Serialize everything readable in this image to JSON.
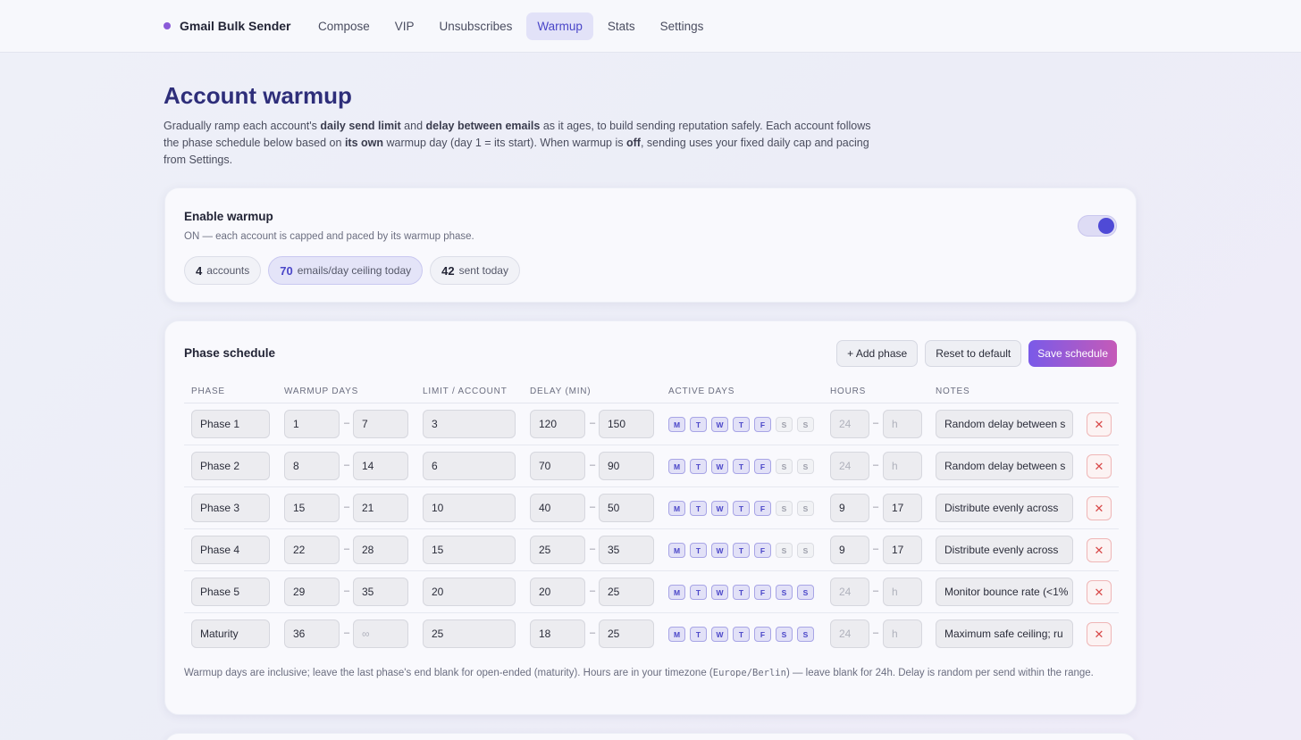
{
  "app": {
    "name": "Gmail Bulk Sender"
  },
  "nav": [
    {
      "label": "Compose",
      "active": false
    },
    {
      "label": "VIP",
      "active": false
    },
    {
      "label": "Unsubscribes",
      "active": false
    },
    {
      "label": "Warmup",
      "active": true
    },
    {
      "label": "Stats",
      "active": false
    },
    {
      "label": "Settings",
      "active": false
    }
  ],
  "page": {
    "title": "Account warmup",
    "intro": {
      "t1": "Gradually ramp each account's ",
      "b1": "daily send limit",
      "t2": " and ",
      "b2": "delay between emails",
      "t3": " as it ages, to build sending reputation safely. Each account follows the phase schedule below based on ",
      "b3": "its own",
      "t4": " warmup day (day 1 = its start). When warmup is ",
      "b4": "off",
      "t5": ", sending uses your fixed daily cap and pacing from Settings."
    }
  },
  "warmup": {
    "title": "Enable warmup",
    "subtitle": "ON — each account is capped and paced by its warmup phase.",
    "enabled": true,
    "stats": [
      {
        "value": "4",
        "label": "accounts"
      },
      {
        "value": "70",
        "label": "emails/day ceiling today"
      },
      {
        "value": "42",
        "label": "sent today"
      }
    ]
  },
  "schedule": {
    "title": "Phase schedule",
    "buttons": {
      "add": "+ Add phase",
      "reset": "Reset to default",
      "save": "Save schedule"
    },
    "columns": [
      "PHASE",
      "WARMUP DAYS",
      "LIMIT / ACCOUNT",
      "DELAY (MIN)",
      "ACTIVE DAYS",
      "HOURS",
      "NOTES"
    ],
    "day_letters": [
      "M",
      "T",
      "W",
      "T",
      "F",
      "S",
      "S"
    ],
    "hour_placeholders": {
      "start": "24",
      "end": "h"
    },
    "dash": "–",
    "rows": [
      {
        "phase": "Phase 1",
        "day_start": "1",
        "day_end": "7",
        "limit": "3",
        "delay_min": "120",
        "delay_max": "150",
        "active": [
          true,
          true,
          true,
          true,
          true,
          false,
          false
        ],
        "hour_start": "",
        "hour_end": "",
        "notes": "Random delay between s"
      },
      {
        "phase": "Phase 2",
        "day_start": "8",
        "day_end": "14",
        "limit": "6",
        "delay_min": "70",
        "delay_max": "90",
        "active": [
          true,
          true,
          true,
          true,
          true,
          false,
          false
        ],
        "hour_start": "",
        "hour_end": "",
        "notes": "Random delay between s"
      },
      {
        "phase": "Phase 3",
        "day_start": "15",
        "day_end": "21",
        "limit": "10",
        "delay_min": "40",
        "delay_max": "50",
        "active": [
          true,
          true,
          true,
          true,
          true,
          false,
          false
        ],
        "hour_start": "9",
        "hour_end": "17",
        "notes": "Distribute evenly across"
      },
      {
        "phase": "Phase 4",
        "day_start": "22",
        "day_end": "28",
        "limit": "15",
        "delay_min": "25",
        "delay_max": "35",
        "active": [
          true,
          true,
          true,
          true,
          true,
          false,
          false
        ],
        "hour_start": "9",
        "hour_end": "17",
        "notes": "Distribute evenly across"
      },
      {
        "phase": "Phase 5",
        "day_start": "29",
        "day_end": "35",
        "limit": "20",
        "delay_min": "20",
        "delay_max": "25",
        "active": [
          true,
          true,
          true,
          true,
          true,
          true,
          true
        ],
        "hour_start": "",
        "hour_end": "",
        "notes": "Monitor bounce rate (<1%"
      },
      {
        "phase": "Maturity",
        "day_start": "36",
        "day_end": "∞",
        "day_end_placeholder": true,
        "limit": "25",
        "delay_min": "18",
        "delay_max": "25",
        "active": [
          true,
          true,
          true,
          true,
          true,
          true,
          true
        ],
        "hour_start": "",
        "hour_end": "",
        "notes": "Maximum safe ceiling; ru"
      }
    ],
    "footnote": {
      "t1": "Warmup days are inclusive; leave the last phase's end blank for open-ended (maturity). Hours are in your timezone (",
      "tz": "Europe/Berlin",
      "t2": ") — leave blank for 24h. Delay is random per send within the range."
    }
  }
}
